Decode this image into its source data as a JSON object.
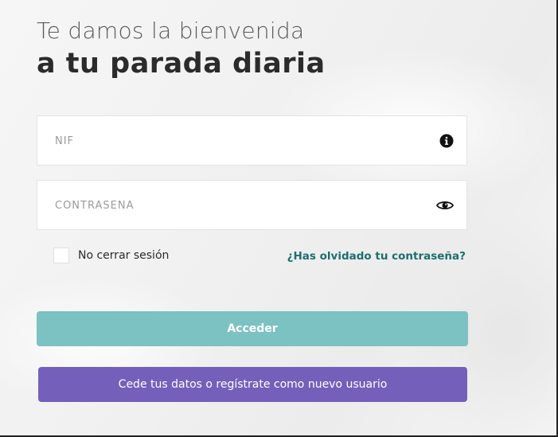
{
  "header": {
    "greeting": "Te damos la bienvenida",
    "tagline": "a tu parada diaria"
  },
  "form": {
    "nif": {
      "placeholder": "NIF",
      "value": "",
      "icon": "info-icon"
    },
    "password": {
      "placeholder": "CONTRASEÑA",
      "value": "",
      "icon": "eye-icon"
    },
    "remember_label": "No cerrar sesión",
    "remember_checked": false,
    "forgot_link": "¿Has olvidado tu contraseña?"
  },
  "buttons": {
    "login_label": "Acceder",
    "register_label": "Cede tus datos o regístrate como nuevo usuario"
  },
  "colors": {
    "accent_teal": "#7cc2c2",
    "link_teal": "#1e6e6e",
    "register_purple": "#7460ba"
  }
}
